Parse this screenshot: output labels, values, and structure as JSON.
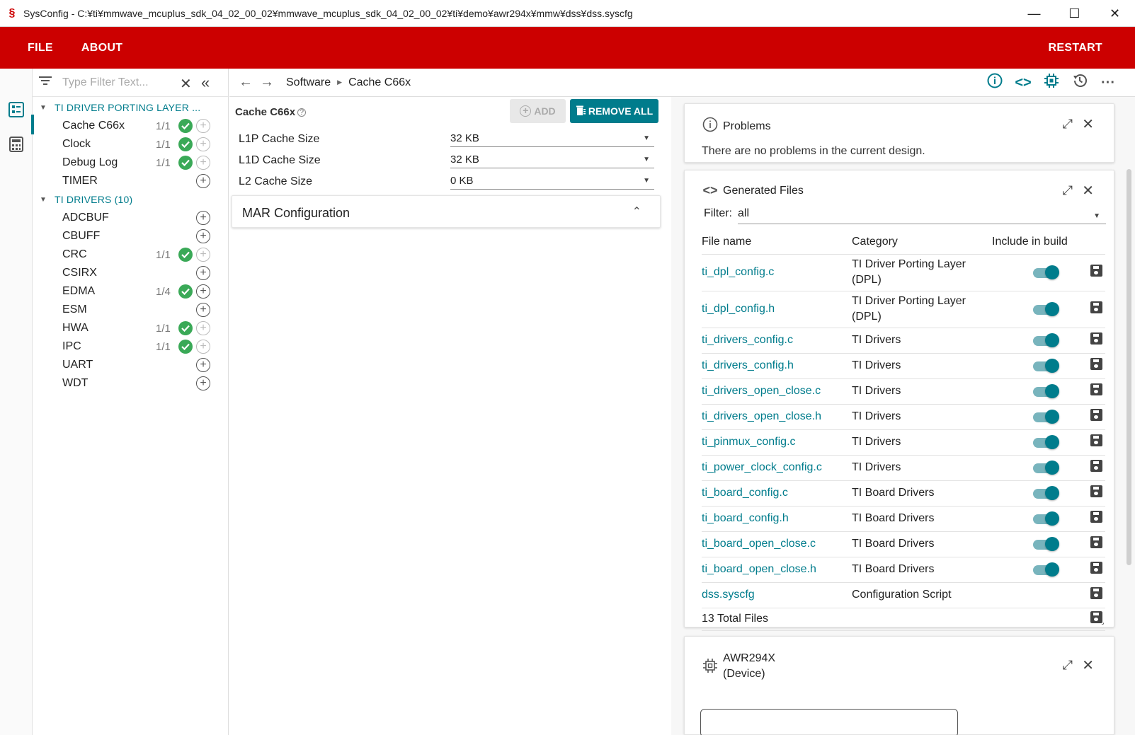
{
  "window": {
    "title": "SysConfig - C:¥ti¥mmwave_mcuplus_sdk_04_02_00_02¥mmwave_mcuplus_sdk_04_02_00_02¥ti¥demo¥awr294x¥mmw¥dss¥dss.syscfg",
    "minimize": "—",
    "maximize": "☐",
    "close": "✕"
  },
  "header": {
    "file": "FILE",
    "about": "ABOUT",
    "restart": "RESTART"
  },
  "tree": {
    "filter_placeholder": "Type Filter Text...",
    "groups": [
      {
        "label": "TI DRIVER PORTING LAYER ...",
        "items": [
          {
            "label": "Cache C66x",
            "count": "1/1"
          },
          {
            "label": "Clock",
            "count": "1/1"
          },
          {
            "label": "Debug Log",
            "count": "1/1"
          },
          {
            "label": "TIMER",
            "count": ""
          }
        ]
      },
      {
        "label": "TI DRIVERS (10)",
        "items": [
          {
            "label": "ADCBUF",
            "count": ""
          },
          {
            "label": "CBUFF",
            "count": ""
          },
          {
            "label": "CRC",
            "count": "1/1"
          },
          {
            "label": "CSIRX",
            "count": ""
          },
          {
            "label": "EDMA",
            "count": "1/4"
          },
          {
            "label": "ESM",
            "count": ""
          },
          {
            "label": "HWA",
            "count": "1/1"
          },
          {
            "label": "IPC",
            "count": "1/1"
          },
          {
            "label": "UART",
            "count": ""
          },
          {
            "label": "WDT",
            "count": ""
          }
        ]
      }
    ]
  },
  "breadcrumb": {
    "items": [
      "Software",
      "Cache C66x"
    ]
  },
  "config": {
    "title": "Cache C66x",
    "add_label": "ADD",
    "remove_all_label": "REMOVE ALL",
    "rows": [
      {
        "name": "L1P Cache Size",
        "value": "32 KB"
      },
      {
        "name": "L1D Cache Size",
        "value": "32 KB"
      },
      {
        "name": "L2 Cache Size",
        "value": "0 KB"
      }
    ],
    "mar_title": "MAR Configuration"
  },
  "problems": {
    "title": "Problems",
    "message": "There are no problems in the current design."
  },
  "generated": {
    "title": "Generated Files",
    "filter_label": "Filter:",
    "filter_value": "all",
    "columns": [
      "File name",
      "Category",
      "Include in build"
    ],
    "files": [
      {
        "name": "ti_dpl_config.c",
        "category": "TI Driver Porting Layer (DPL)",
        "include": true
      },
      {
        "name": "ti_dpl_config.h",
        "category": "TI Driver Porting Layer (DPL)",
        "include": true
      },
      {
        "name": "ti_drivers_config.c",
        "category": "TI Drivers",
        "include": true
      },
      {
        "name": "ti_drivers_config.h",
        "category": "TI Drivers",
        "include": true
      },
      {
        "name": "ti_drivers_open_close.c",
        "category": "TI Drivers",
        "include": true
      },
      {
        "name": "ti_drivers_open_close.h",
        "category": "TI Drivers",
        "include": true
      },
      {
        "name": "ti_pinmux_config.c",
        "category": "TI Drivers",
        "include": true
      },
      {
        "name": "ti_power_clock_config.c",
        "category": "TI Drivers",
        "include": true
      },
      {
        "name": "ti_board_config.c",
        "category": "TI Board Drivers",
        "include": true
      },
      {
        "name": "ti_board_config.h",
        "category": "TI Board Drivers",
        "include": true
      },
      {
        "name": "ti_board_open_close.c",
        "category": "TI Board Drivers",
        "include": true
      },
      {
        "name": "ti_board_open_close.h",
        "category": "TI Board Drivers",
        "include": true
      },
      {
        "name": "dss.syscfg",
        "category": "Configuration Script",
        "include": false
      }
    ],
    "total": "13 Total Files"
  },
  "device": {
    "name": "AWR294X",
    "type": "(Device)"
  },
  "colors": {
    "brand_red": "#cc0000",
    "accent_teal": "#007c8c",
    "check_green": "#3aa957"
  }
}
